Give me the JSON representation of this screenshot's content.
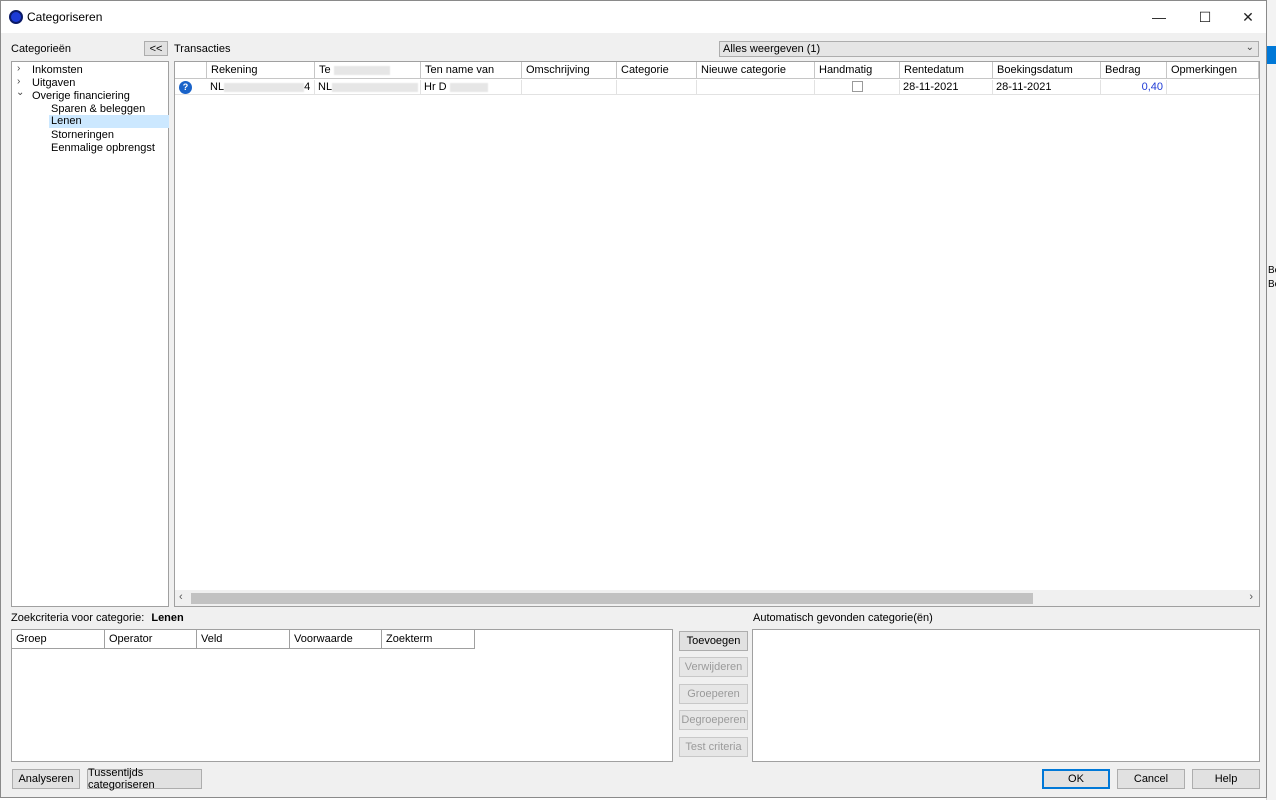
{
  "window": {
    "title": "Categoriseren",
    "minimize_glyph": "—",
    "maximize_glyph": "☐",
    "close_glyph": "✕"
  },
  "categories": {
    "label": "Categorieën",
    "collapse_label": "<<",
    "tree": {
      "inkomsten": "Inkomsten",
      "uitgaven": "Uitgaven",
      "overige": "Overige financiering",
      "sparen": "Sparen & beleggen",
      "lenen": "Lenen",
      "storneringen": "Storneringen",
      "eenmalige": "Eenmalige opbrengst"
    },
    "arrow_collapsed": "›",
    "arrow_expanded": "⌄"
  },
  "transactions": {
    "label": "Transacties",
    "filter": "Alles weergeven (1)",
    "dropdown_glyph": "⌄",
    "columns": {
      "rekening": "Rekening",
      "tegen": "Te",
      "ten_name_van": "Ten name van",
      "omschrijving": "Omschrijving",
      "categorie": "Categorie",
      "nieuwe_categorie": "Nieuwe categorie",
      "handmatig": "Handmatig",
      "rentedatum": "Rentedatum",
      "boekingsdatum": "Boekingsdatum",
      "bedrag": "Bedrag",
      "opmerkingen": "Opmerkingen"
    },
    "row": {
      "status_glyph": "?",
      "rekening_prefix": "NL",
      "rekening_suffix": "4",
      "tegen_prefix": "NL",
      "ten_name_van": "Hr D",
      "rentedatum": "28-11-2021",
      "boekingsdatum": "28-11-2021",
      "bedrag": "0,40"
    },
    "scroll_left": "‹",
    "scroll_right": "›"
  },
  "criteria": {
    "label": "Zoekcriteria voor categorie:",
    "category": "Lenen",
    "columns": {
      "groep": "Groep",
      "operator": "Operator",
      "veld": "Veld",
      "voorwaarde": "Voorwaarde",
      "zoekterm": "Zoekterm"
    },
    "buttons": {
      "toevoegen": "Toevoegen",
      "verwijderen": "Verwijderen",
      "groeperen": "Groeperen",
      "degroeperen": "Degroeperen",
      "test": "Test criteria"
    }
  },
  "auto_found": {
    "label": "Automatisch gevonden categorie(ën)"
  },
  "footer": {
    "analyseren": "Analyseren",
    "tussentijds": "Tussentijds categoriseren",
    "ok": "OK",
    "cancel": "Cancel",
    "help": "Help"
  },
  "desktop": {
    "fragment1": "Be",
    "fragment2": "Be"
  },
  "colors": {
    "selection": "#cce8ff",
    "amount": "#1f3bd6",
    "accent": "#0078d7"
  }
}
